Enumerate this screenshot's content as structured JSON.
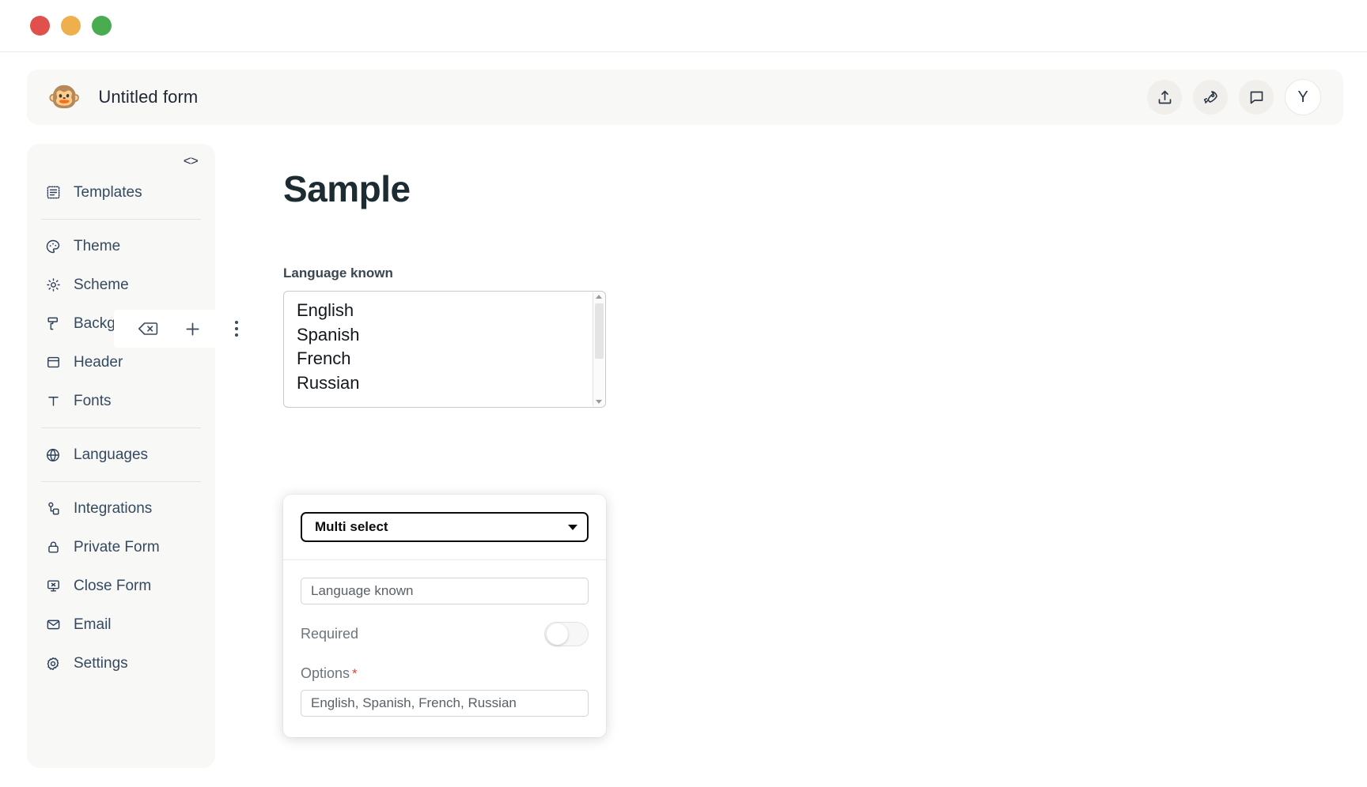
{
  "window": {
    "traffic_lights": [
      "close",
      "minimize",
      "zoom"
    ],
    "colors": {
      "close": "#e0514b",
      "minimize": "#efaf4c",
      "zoom": "#4aac51"
    }
  },
  "appbar": {
    "logo_icon": "monkey-face-logo",
    "title": "Untitled form",
    "actions": [
      {
        "name": "share-icon",
        "glyph": "share"
      },
      {
        "name": "rocket-publish-icon",
        "glyph": "rocket"
      },
      {
        "name": "comment-icon",
        "glyph": "comment"
      }
    ],
    "avatar_initial": "Y"
  },
  "sidebar": {
    "code_toggle": "<>",
    "items": [
      {
        "label": "Templates",
        "icon": "templates-icon"
      },
      {
        "label": "Theme",
        "icon": "palette-icon"
      },
      {
        "label": "Scheme",
        "icon": "sun-icon"
      },
      {
        "label": "Background",
        "icon": "paint-roller-icon"
      },
      {
        "label": "Header",
        "icon": "header-layout-icon"
      },
      {
        "label": "Fonts",
        "icon": "text-t-icon"
      },
      {
        "label": "Languages",
        "icon": "globe-icon"
      },
      {
        "label": "Integrations",
        "icon": "integrations-icon"
      },
      {
        "label": "Private Form",
        "icon": "lock-icon"
      },
      {
        "label": "Close Form",
        "icon": "close-form-icon"
      },
      {
        "label": "Email",
        "icon": "envelope-icon"
      },
      {
        "label": "Settings",
        "icon": "gear-icon"
      }
    ]
  },
  "block_toolbar": {
    "delete_icon": "backspace-delete-icon",
    "add_icon": "plus-icon",
    "more_icon": "kebab-menu-icon"
  },
  "form": {
    "heading": "Sample",
    "field": {
      "label": "Language known",
      "options": [
        "English",
        "Spanish",
        "French",
        "Russian"
      ]
    }
  },
  "settings_panel": {
    "field_type": "Multi select",
    "label_value": "Language known",
    "required_label": "Required",
    "required_on": false,
    "options_label": "Options",
    "options_required_marker": "*",
    "options_value": "English, Spanish, French, Russian"
  }
}
